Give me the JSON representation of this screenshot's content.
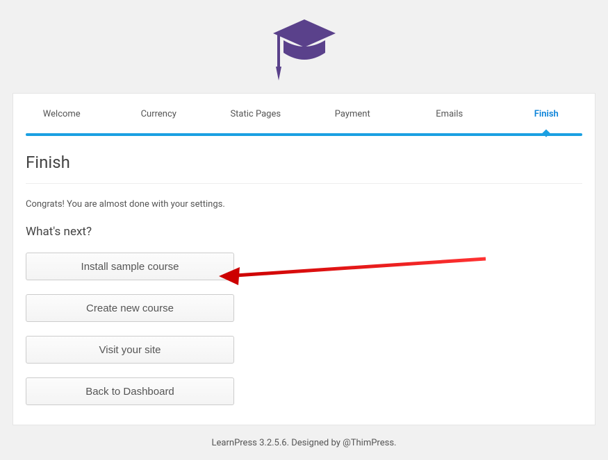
{
  "tabs": {
    "items": [
      {
        "label": "Welcome"
      },
      {
        "label": "Currency"
      },
      {
        "label": "Static Pages"
      },
      {
        "label": "Payment"
      },
      {
        "label": "Emails"
      },
      {
        "label": "Finish"
      }
    ],
    "active_index": 5
  },
  "page": {
    "title": "Finish",
    "congrats": "Congrats! You are almost done with your settings.",
    "sub_heading": "What's next?"
  },
  "buttons": {
    "install": "Install sample course",
    "create": "Create new course",
    "visit": "Visit your site",
    "dashboard": "Back to Dashboard"
  },
  "footer": {
    "text": "LearnPress 3.2.5.6. Designed by @ThimPress."
  }
}
